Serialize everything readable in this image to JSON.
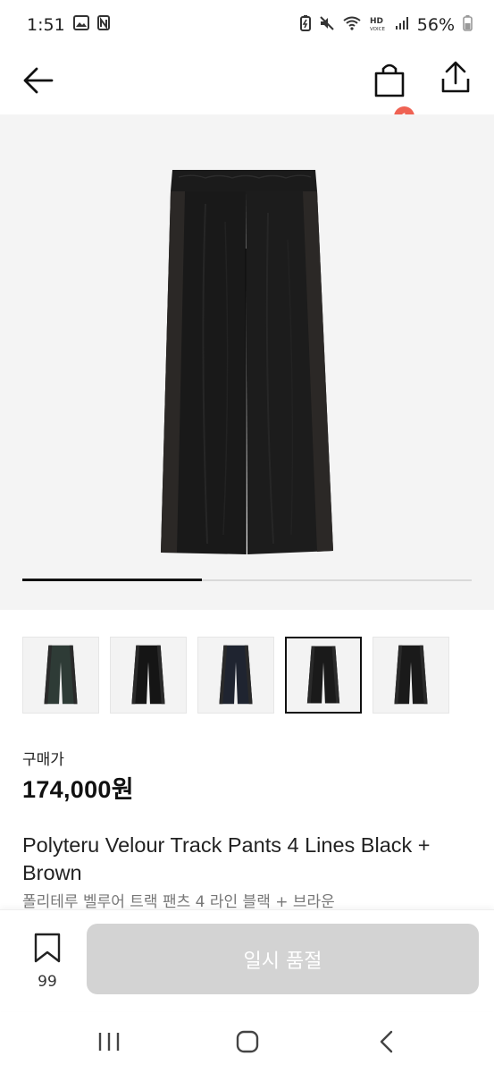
{
  "status_bar": {
    "time": "1:51",
    "battery": "56%"
  },
  "header": {
    "cart_count": "1"
  },
  "gallery": {
    "total_images": 5,
    "current_image": 2,
    "thumbnails": [
      {
        "index": 1,
        "selected": false
      },
      {
        "index": 2,
        "selected": false
      },
      {
        "index": 3,
        "selected": false
      },
      {
        "index": 4,
        "selected": true
      },
      {
        "index": 5,
        "selected": false
      }
    ]
  },
  "product": {
    "price_label": "구매가",
    "price": "174,000원",
    "title_en": "Polyteru Velour Track Pants 4 Lines Black + Brown",
    "title_ko": "폴리테루 벨루어 트랙 팬츠 4 라인 블랙 + 브라운"
  },
  "bottom_bar": {
    "wish_count": "99",
    "soldout_label": "일시 품절"
  },
  "colors": {
    "badge": "#ef6253",
    "soldout_button": "#d3d3d3"
  }
}
